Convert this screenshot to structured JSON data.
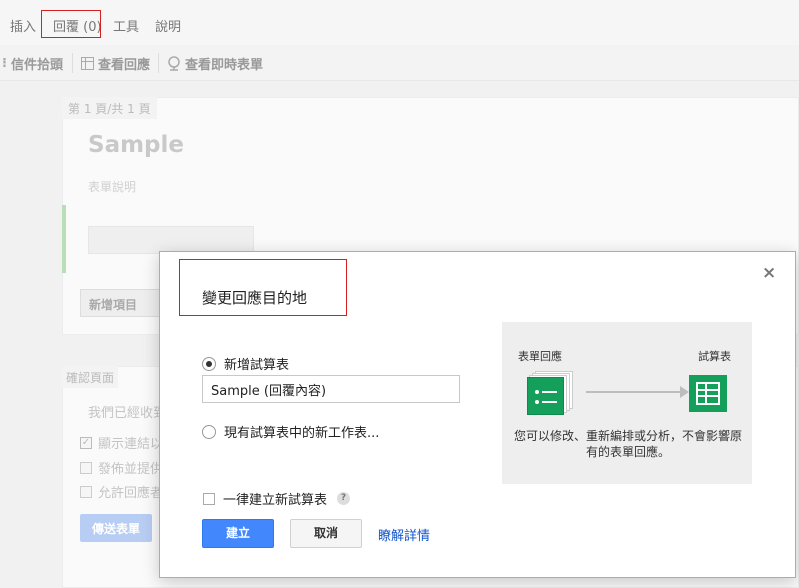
{
  "menubar": {
    "items": [
      "插入",
      "回覆 (0)",
      "工具",
      "說明"
    ]
  },
  "toolbar": {
    "inbox_label": "信件拾頭",
    "view_responses_label": "查看回應",
    "view_live_form_label": "查看即時表單"
  },
  "form": {
    "page_indicator": "第 1 頁/共 1 頁",
    "title": "Sample",
    "description_placeholder": "表單說明",
    "add_item_label": "新增項目"
  },
  "confirmation": {
    "tab_label": "確認頁面",
    "message": "我們已經收到",
    "options": [
      "顯示連結以",
      "發佈並提供",
      "允許回應者"
    ],
    "send_button": "傳送表單"
  },
  "dialog": {
    "title": "變更回應目的地",
    "close_symbol": "×",
    "option_new_spreadsheet": "新增試算表",
    "new_spreadsheet_name": "Sample (回覆內容)",
    "option_existing_sheet": "現有試算表中的新工作表...",
    "always_create_label": "一律建立新試算表",
    "help_symbol": "?",
    "create_button": "建立",
    "cancel_button": "取消",
    "learn_more_link": "瞭解詳情"
  },
  "illustration": {
    "source_label": "表單回應",
    "target_label": "試算表",
    "caption_line1": "您可以修改、重新編排或分析，不會影響原",
    "caption_line2": "有的表單回應。"
  },
  "colors": {
    "accent_blue": "#4387fd",
    "link_blue": "#1155cc",
    "forms_green": "#14a05a",
    "highlight_red": "#d52020"
  }
}
